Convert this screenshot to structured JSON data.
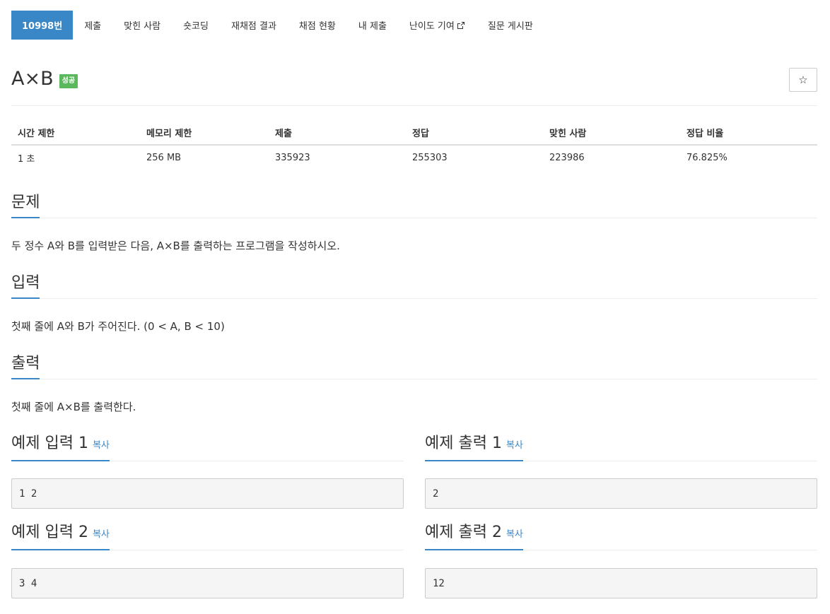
{
  "nav": {
    "problem_id": "10998번",
    "submit": "제출",
    "solved_users": "맞힌 사람",
    "short_coding": "숏코딩",
    "rejudge": "재채점 결과",
    "judge_status": "채점 현황",
    "my_submissions": "내 제출",
    "difficulty": "난이도 기여",
    "board": "질문 게시판"
  },
  "problem": {
    "title": "A×B",
    "badge": "성공",
    "star_icon": "☆"
  },
  "info": {
    "headers": [
      "시간 제한",
      "메모리 제한",
      "제출",
      "정답",
      "맞힌 사람",
      "정답 비율"
    ],
    "values": [
      "1 초",
      "256 MB",
      "335923",
      "255303",
      "223986",
      "76.825%"
    ]
  },
  "sections": {
    "description_title": "문제",
    "description": "두 정수 A와 B를 입력받은 다음, A×B를 출력하는 프로그램을 작성하시오.",
    "input_title": "입력",
    "input": "첫째 줄에 A와 B가 주어진다. (0 < A, B < 10)",
    "output_title": "출력",
    "output": "첫째 줄에 A×B를 출력한다."
  },
  "samples": {
    "copy_label": "복사",
    "input1_title": "예제 입력 1",
    "input1": "1 2",
    "output1_title": "예제 출력 1",
    "output1": "2",
    "input2_title": "예제 입력 2",
    "input2": "3 4",
    "output2_title": "예제 출력 2",
    "output2": "12"
  },
  "colors": {
    "accent": "#3a87c8",
    "success": "#5cb85c"
  }
}
